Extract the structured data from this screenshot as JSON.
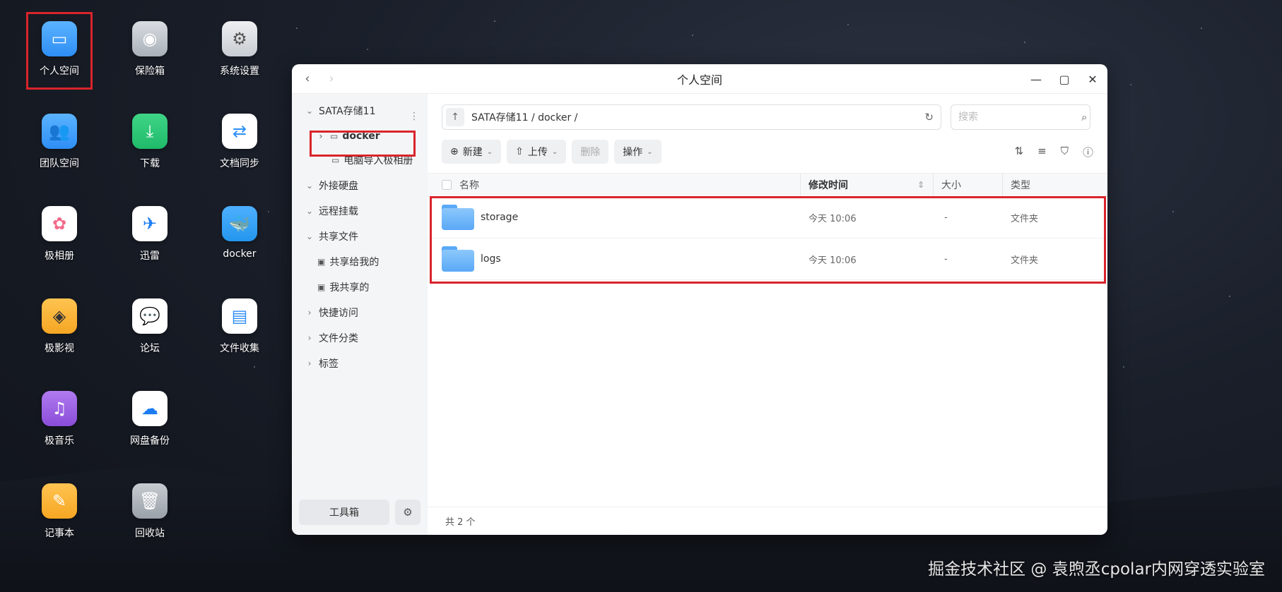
{
  "desktop": {
    "apps": [
      {
        "label": "个人空间",
        "icon": "folder-icon",
        "color": "#2e8ef5"
      },
      {
        "label": "保险箱",
        "icon": "safe-icon",
        "color": "#a9b0b8"
      },
      {
        "label": "系统设置",
        "icon": "settings-icon",
        "color": "#7d8490"
      },
      {
        "label": "团队空间",
        "icon": "team-icon",
        "color": "#2e8ef5"
      },
      {
        "label": "下载",
        "icon": "download-icon",
        "color": "#1fba6a"
      },
      {
        "label": "文档同步",
        "icon": "sync-icon",
        "color": "#ffffff"
      },
      {
        "label": "极相册",
        "icon": "photos-icon",
        "color": "#ffffff"
      },
      {
        "label": "迅雷",
        "icon": "xunlei-icon",
        "color": "#ffffff"
      },
      {
        "label": "docker",
        "icon": "docker-icon",
        "color": "#2496ed"
      },
      {
        "label": "极影视",
        "icon": "video-icon",
        "color": "#f5a623"
      },
      {
        "label": "论坛",
        "icon": "forum-icon",
        "color": "#ffffff"
      },
      {
        "label": "文件收集",
        "icon": "collect-icon",
        "color": "#ffffff"
      },
      {
        "label": "极音乐",
        "icon": "music-icon",
        "color": "#8a4dd8"
      },
      {
        "label": "网盘备份",
        "icon": "cloud-backup-icon",
        "color": "#ffffff"
      },
      {
        "label": "记事本",
        "icon": "notepad-icon",
        "color": "#f6a623"
      },
      {
        "label": "回收站",
        "icon": "trash-icon",
        "color": "#9aa1a8"
      }
    ]
  },
  "window": {
    "title": "个人空间",
    "sidebar": {
      "root": "SATA存储11",
      "selected": "docker",
      "child": "电脑导入极相册",
      "sections": [
        "外接硬盘",
        "远程挂载",
        "共享文件"
      ],
      "shared_items": [
        "共享给我的",
        "我共享的"
      ],
      "collapsed_sections": [
        "快捷访问",
        "文件分类",
        "标签"
      ],
      "toolbox_label": "工具箱"
    },
    "path": {
      "text": "SATA存储11 / docker /"
    },
    "search": {
      "placeholder": "搜索"
    },
    "actions": {
      "new": "新建",
      "upload": "上传",
      "delete": "删除",
      "operate": "操作"
    },
    "columns": {
      "name": "名称",
      "modified": "修改时间",
      "size": "大小",
      "type": "类型"
    },
    "rows": [
      {
        "name": "storage",
        "modified": "今天 10:06",
        "size": "-",
        "type": "文件夹"
      },
      {
        "name": "logs",
        "modified": "今天 10:06",
        "size": "-",
        "type": "文件夹"
      }
    ],
    "status": "共 2 个"
  },
  "watermark": "掘金技术社区 @ 袁煦丞cpolar内网穿透实验室",
  "accent": "#d9242b"
}
